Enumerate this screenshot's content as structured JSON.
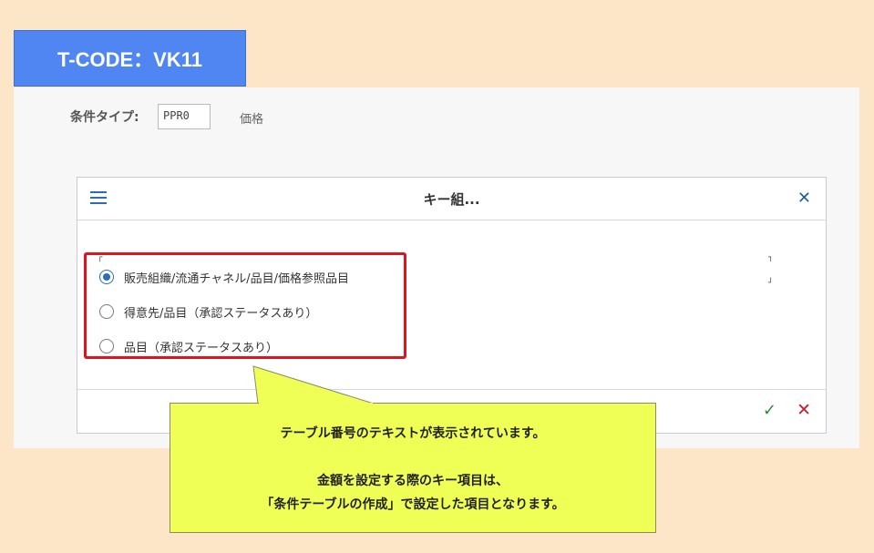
{
  "tcode": "T-CODE：VK11",
  "condition": {
    "label": "条件タイプ:",
    "value": "PPR0",
    "description": "価格"
  },
  "dialog": {
    "title": "キー組...",
    "options": [
      {
        "label": "販売組織/流通チャネル/品目/価格参照品目",
        "selected": true
      },
      {
        "label": "得意先/品目（承認ステータスあり）",
        "selected": false
      },
      {
        "label": "品目（承認ステータスあり）",
        "selected": false
      }
    ]
  },
  "icons": {
    "menu": "hamburger-menu-icon",
    "close": "close-icon",
    "ok": "checkmark-icon",
    "cancel": "cancel-icon"
  },
  "callout": {
    "line1": "テーブル番号のテキストが表示されています。",
    "line2": "金額を設定する際のキー項目は、",
    "line3": "「条件テーブルの作成」で設定した項目となります。"
  },
  "colors": {
    "background": "#fde5c8",
    "tcode_bg": "#4f86f2",
    "highlight": "#e0141e",
    "callout_bg": "#f0ff55",
    "sap_blue": "#2a6db5"
  }
}
